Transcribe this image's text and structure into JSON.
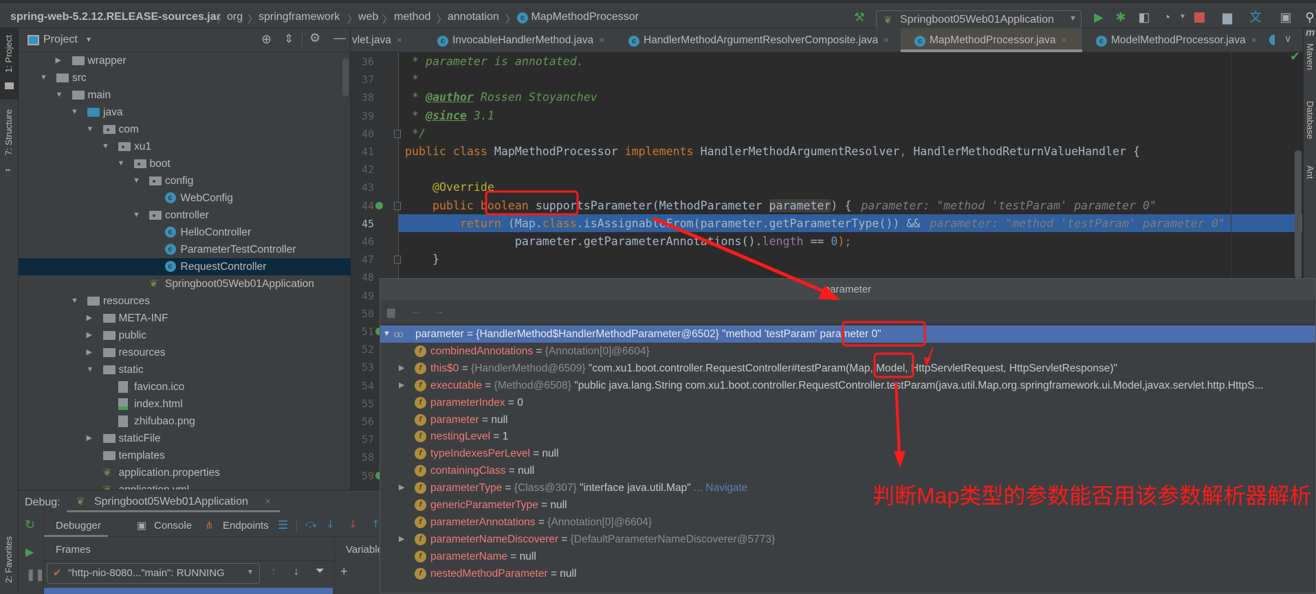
{
  "breadcrumb": [
    "spring-web-5.2.12.RELEASE-sources.jar",
    "org",
    "springframework",
    "web",
    "method",
    "annotation",
    "MapMethodProcessor"
  ],
  "run_config": "Springboot05Web01Application",
  "toolbar_icons": [
    "build-hammer-icon",
    "run-icon",
    "debug-icon",
    "coverage-icon",
    "profiler-icon",
    "stop-icon",
    "project-structure-icon",
    "translate-icon",
    "terminal-icon",
    "search-icon"
  ],
  "left_strip": {
    "project": "1: Project",
    "structure": "7: Structure",
    "favorites": "2: Favorites"
  },
  "right_strip": [
    "Maven",
    "Database",
    "Ant"
  ],
  "project_panel": {
    "title": "Project",
    "items": [
      {
        "label": "wrapper",
        "level": 3,
        "kind": "folder",
        "state": "collapsed"
      },
      {
        "label": "src",
        "level": 2,
        "kind": "folder",
        "state": "expanded"
      },
      {
        "label": "main",
        "level": 3,
        "kind": "folder",
        "state": "expanded"
      },
      {
        "label": "java",
        "level": 4,
        "kind": "source-folder",
        "state": "expanded"
      },
      {
        "label": "com",
        "level": 5,
        "kind": "package",
        "state": "expanded"
      },
      {
        "label": "xu1",
        "level": 6,
        "kind": "package",
        "state": "expanded"
      },
      {
        "label": "boot",
        "level": 7,
        "kind": "package",
        "state": "expanded"
      },
      {
        "label": "config",
        "level": 8,
        "kind": "package",
        "state": "expanded"
      },
      {
        "label": "WebConfig",
        "level": 9,
        "kind": "class"
      },
      {
        "label": "controller",
        "level": 8,
        "kind": "package",
        "state": "expanded"
      },
      {
        "label": "HelloController",
        "level": 9,
        "kind": "class"
      },
      {
        "label": "ParameterTestController",
        "level": 9,
        "kind": "class"
      },
      {
        "label": "RequestController",
        "level": 9,
        "kind": "class",
        "selected": true
      },
      {
        "label": "Springboot05Web01Application",
        "level": 8,
        "kind": "spring-class"
      },
      {
        "label": "resources",
        "level": 4,
        "kind": "resources-folder",
        "state": "expanded"
      },
      {
        "label": "META-INF",
        "level": 5,
        "kind": "folder",
        "state": "collapsed"
      },
      {
        "label": "public",
        "level": 5,
        "kind": "folder",
        "state": "collapsed"
      },
      {
        "label": "resources",
        "level": 5,
        "kind": "folder",
        "state": "collapsed"
      },
      {
        "label": "static",
        "level": 5,
        "kind": "folder",
        "state": "expanded"
      },
      {
        "label": "favicon.ico",
        "level": 6,
        "kind": "image"
      },
      {
        "label": "index.html",
        "level": 6,
        "kind": "html"
      },
      {
        "label": "zhifubao.png",
        "level": 6,
        "kind": "image"
      },
      {
        "label": "staticFile",
        "level": 5,
        "kind": "folder",
        "state": "collapsed"
      },
      {
        "label": "templates",
        "level": 5,
        "kind": "folder"
      },
      {
        "label": "application.properties",
        "level": 5,
        "kind": "spring-config"
      },
      {
        "label": "application.yml",
        "level": 5,
        "kind": "spring-config"
      }
    ]
  },
  "editor_tabs": [
    {
      "label": "vlet.java"
    },
    {
      "label": "InvocableHandlerMethod.java"
    },
    {
      "label": "HandlerMethodArgumentResolverComposite.java"
    },
    {
      "label": "MapMethodProcessor.java",
      "active": true
    },
    {
      "label": "ModelMethodProcessor.java"
    }
  ],
  "code": {
    "first_line": 36,
    "last_line": 59,
    "execution_line": 45,
    "lines": [
      [
        [
          " * parameter is annotated.",
          "doc"
        ]
      ],
      [
        [
          " *",
          "doc"
        ]
      ],
      [
        [
          " * ",
          "doc"
        ],
        [
          "@author",
          "doctag"
        ],
        [
          " Rossen Stoyanchev",
          "doc"
        ]
      ],
      [
        [
          " * ",
          "doc"
        ],
        [
          "@since",
          "doctag"
        ],
        [
          " 3.1",
          "doc"
        ]
      ],
      [
        [
          " */",
          "doc"
        ]
      ],
      [
        [
          "public class ",
          "kw"
        ],
        [
          "MapMethodProcessor ",
          ""
        ],
        [
          "implements ",
          "kw"
        ],
        [
          "HandlerMethodArgumentResolver",
          ""
        ],
        [
          ", ",
          "kw"
        ],
        [
          "HandlerMethodReturnValueHandler {",
          ""
        ]
      ],
      [],
      [
        [
          "    ",
          ""
        ],
        [
          "@Override",
          "ann"
        ]
      ],
      [
        [
          "    ",
          ""
        ],
        [
          "public boolean ",
          "kw"
        ],
        [
          "supportsParameter(MethodParameter ",
          ""
        ],
        [
          "parameter",
          "usage"
        ],
        [
          ") {",
          ""
        ],
        [
          "parameter: \"method 'testParam' parameter 0\"",
          "hint"
        ]
      ],
      [
        [
          "        ",
          ""
        ],
        [
          "return ",
          "kw"
        ],
        [
          "(Map.",
          ""
        ],
        [
          "class",
          "kw"
        ],
        [
          ".isAssignableFrom(parameter.getParameterType()) &&",
          ""
        ],
        [
          "parameter: \"method 'testParam' parameter 0\"",
          "hint"
        ]
      ],
      [
        [
          "                parameter.getParameterAnnotations().",
          ""
        ],
        [
          "length",
          "fld"
        ],
        [
          " == ",
          ""
        ],
        [
          "0",
          "num"
        ],
        [
          ");",
          "kw"
        ]
      ],
      [
        [
          "    }",
          ""
        ]
      ]
    ]
  },
  "debug": {
    "label": "Debug:",
    "session": "Springboot05Web01Application",
    "tabs": [
      "Debugger",
      "Console",
      "Endpoints"
    ],
    "frames_label": "Frames",
    "variables_label": "Variables",
    "thread": "\"http-nio-8080...\"main\": RUNNING"
  },
  "popup": {
    "title": "parameter",
    "rows": [
      {
        "name": "parameter",
        "ref": "{HandlerMethod$HandlerMethodParameter@6502}",
        "value": "\"method 'testParam' parameter 0\"",
        "expandable": true,
        "expanded": true,
        "selected": true,
        "icon": "watch-glasses-icon"
      },
      {
        "name": "combinedAnnotations",
        "ref": "{Annotation[0]@6604}",
        "icon": "field-icon"
      },
      {
        "name": "this$0",
        "ref": "{HandlerMethod@6509}",
        "value": "\"com.xu1.boot.controller.RequestController#testParam(Map, Model, HttpServletRequest, HttpServletResponse)\"",
        "expandable": true,
        "icon": "final-field-icon"
      },
      {
        "name": "executable",
        "ref": "{Method@6508}",
        "value": "\"public java.lang.String com.xu1.boot.controller.RequestController.testParam(java.util.Map,org.springframework.ui.Model,javax.servlet.http.HttpS...",
        "expandable": true,
        "icon": "final-field-icon"
      },
      {
        "name": "parameterIndex",
        "value": "0",
        "icon": "final-field-icon"
      },
      {
        "name": "parameter",
        "value": "null",
        "icon": "field-icon"
      },
      {
        "name": "nestingLevel",
        "value": "1",
        "icon": "field-icon"
      },
      {
        "name": "typeIndexesPerLevel",
        "value": "null",
        "icon": "field-icon"
      },
      {
        "name": "containingClass",
        "value": "null",
        "icon": "field-icon"
      },
      {
        "name": "parameterType",
        "ref": "{Class@307}",
        "value": "\"interface java.util.Map\"",
        "navigate": "... Navigate",
        "expandable": true,
        "icon": "field-icon"
      },
      {
        "name": "genericParameterType",
        "value": "null",
        "icon": "field-icon"
      },
      {
        "name": "parameterAnnotations",
        "ref": "{Annotation[0]@6604}",
        "icon": "field-icon"
      },
      {
        "name": "parameterNameDiscoverer",
        "ref": "{DefaultParameterNameDiscoverer@5773}",
        "expandable": true,
        "icon": "field-icon"
      },
      {
        "name": "parameterName",
        "value": "null",
        "icon": "field-icon"
      },
      {
        "name": "nestedMethodParameter",
        "value": "null",
        "icon": "field-icon"
      }
    ]
  },
  "annotation": {
    "note": "判断Map类型的参数能否用该参数解析器解析",
    "color": "#ff1a1a"
  },
  "colors": {
    "selection": "#4b6eaf",
    "execution_line": "#2f5f9c",
    "tree_selection": "#0d293e"
  }
}
